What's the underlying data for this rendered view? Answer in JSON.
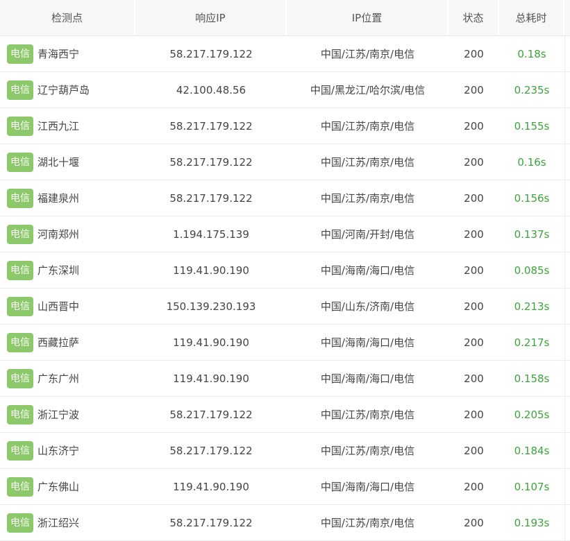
{
  "header": {
    "node": "检测点",
    "ip": "响应IP",
    "location": "IP位置",
    "status": "状态",
    "time": "总耗时"
  },
  "rows": [
    {
      "isp": "电信",
      "node": "青海西宁",
      "ip": "58.217.179.122",
      "location": "中国/江苏/南京/电信",
      "status": "200",
      "time": "0.18s"
    },
    {
      "isp": "电信",
      "node": "辽宁葫芦岛",
      "ip": "42.100.48.56",
      "location": "中国/黑龙江/哈尔滨/电信",
      "status": "200",
      "time": "0.235s"
    },
    {
      "isp": "电信",
      "node": "江西九江",
      "ip": "58.217.179.122",
      "location": "中国/江苏/南京/电信",
      "status": "200",
      "time": "0.155s"
    },
    {
      "isp": "电信",
      "node": "湖北十堰",
      "ip": "58.217.179.122",
      "location": "中国/江苏/南京/电信",
      "status": "200",
      "time": "0.16s"
    },
    {
      "isp": "电信",
      "node": "福建泉州",
      "ip": "58.217.179.122",
      "location": "中国/江苏/南京/电信",
      "status": "200",
      "time": "0.156s"
    },
    {
      "isp": "电信",
      "node": "河南郑州",
      "ip": "1.194.175.139",
      "location": "中国/河南/开封/电信",
      "status": "200",
      "time": "0.137s"
    },
    {
      "isp": "电信",
      "node": "广东深圳",
      "ip": "119.41.90.190",
      "location": "中国/海南/海口/电信",
      "status": "200",
      "time": "0.085s"
    },
    {
      "isp": "电信",
      "node": "山西晋中",
      "ip": "150.139.230.193",
      "location": "中国/山东/济南/电信",
      "status": "200",
      "time": "0.213s"
    },
    {
      "isp": "电信",
      "node": "西藏拉萨",
      "ip": "119.41.90.190",
      "location": "中国/海南/海口/电信",
      "status": "200",
      "time": "0.217s"
    },
    {
      "isp": "电信",
      "node": "广东广州",
      "ip": "119.41.90.190",
      "location": "中国/海南/海口/电信",
      "status": "200",
      "time": "0.158s"
    },
    {
      "isp": "电信",
      "node": "浙江宁波",
      "ip": "58.217.179.122",
      "location": "中国/江苏/南京/电信",
      "status": "200",
      "time": "0.205s"
    },
    {
      "isp": "电信",
      "node": "山东济宁",
      "ip": "58.217.179.122",
      "location": "中国/江苏/南京/电信",
      "status": "200",
      "time": "0.184s"
    },
    {
      "isp": "电信",
      "node": "广东佛山",
      "ip": "119.41.90.190",
      "location": "中国/海南/海口/电信",
      "status": "200",
      "time": "0.107s"
    },
    {
      "isp": "电信",
      "node": "浙江绍兴",
      "ip": "58.217.179.122",
      "location": "中国/江苏/南京/电信",
      "status": "200",
      "time": "0.193s"
    }
  ],
  "colors": {
    "isp_badge": "#8cc96a",
    "time_text": "#3aa53a",
    "header_bg": "#f7f7f7"
  }
}
